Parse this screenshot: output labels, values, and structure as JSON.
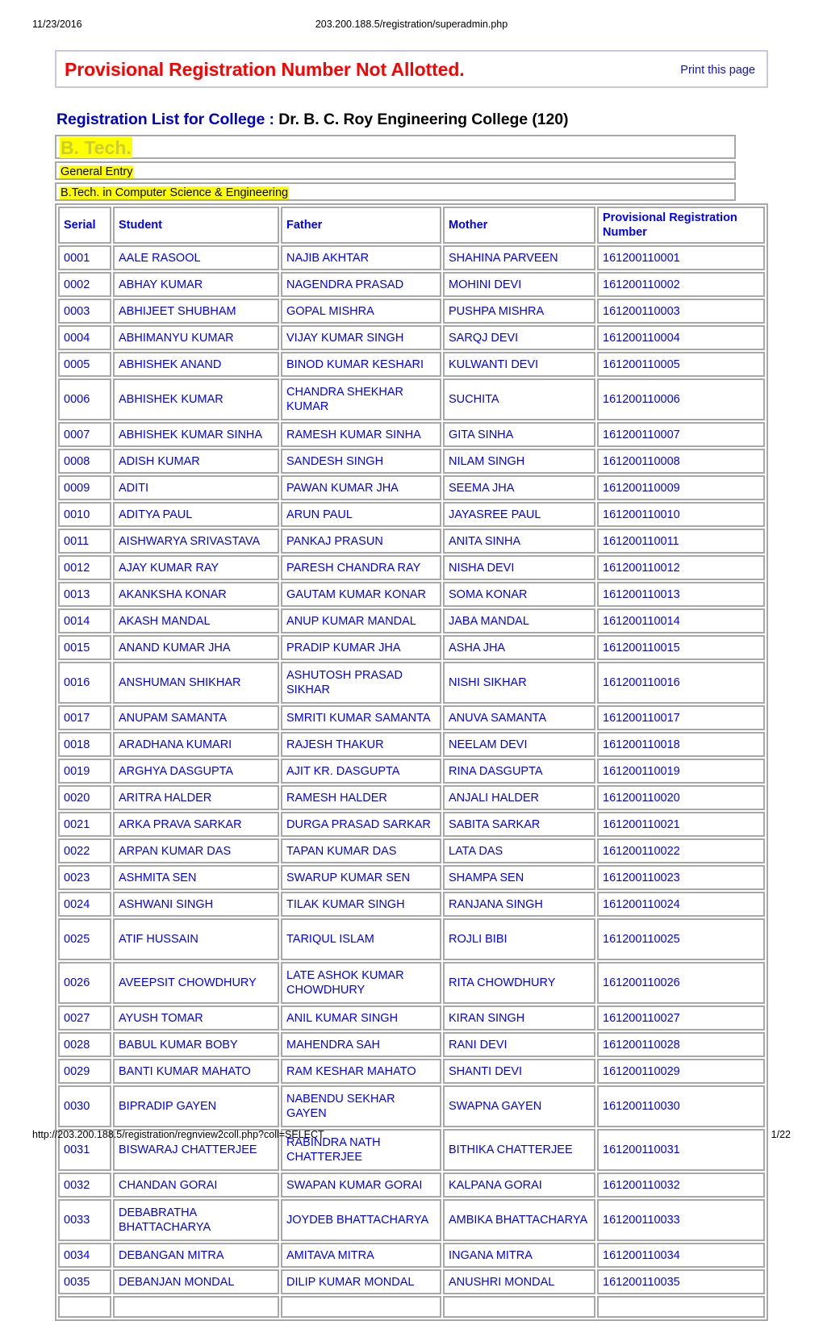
{
  "print_header": {
    "date": "11/23/2016",
    "url": "203.200.188.5/registration/superadmin.php"
  },
  "print_footer": {
    "url": "http://203.200.188.5/registration/regnview2coll.php?coll=SELECT",
    "page": "1/22"
  },
  "banner": {
    "title": "Provisional Registration Number Not Allotted.",
    "print_link": "Print this page",
    "border_color": "#c8c8e0",
    "title_color": "#ff0000",
    "link_color": "#1111cc"
  },
  "heading": {
    "label": "Registration List for College : ",
    "college": "Dr. B. C. Roy Engineering College (120)",
    "label_color": "#0000cd"
  },
  "highlight_rows": [
    {
      "text": "B. Tech.",
      "style": "degree",
      "text_color": "#cdcd32",
      "background": "#ffff00"
    },
    {
      "text": "General Entry",
      "style": "plain",
      "text_color": "#000000",
      "background": "#ffff00"
    },
    {
      "text": "B.Tech. in Computer Science & Engineering",
      "style": "plain",
      "text_color": "#000000",
      "background": "#ffff00"
    }
  ],
  "table": {
    "columns": [
      "Serial",
      "Student",
      "Father",
      "Mother",
      "Provisional Registration Number"
    ],
    "text_color": "#0000ff",
    "border_color": "#a8a8a8",
    "rows": [
      {
        "serial": "0001",
        "student": "AALE RASOOL",
        "father": "NAJIB AKHTAR",
        "mother": "SHAHINA PARVEEN",
        "prn": "161200110001",
        "lines": 1
      },
      {
        "serial": "0002",
        "student": "ABHAY KUMAR",
        "father": "NAGENDRA PRASAD",
        "mother": "MOHINI DEVI",
        "prn": "161200110002",
        "lines": 1
      },
      {
        "serial": "0003",
        "student": "ABHIJEET SHUBHAM",
        "father": "GOPAL MISHRA",
        "mother": "PUSHPA MISHRA",
        "prn": "161200110003",
        "lines": 1
      },
      {
        "serial": "0004",
        "student": "ABHIMANYU KUMAR",
        "father": "VIJAY KUMAR SINGH",
        "mother": "SARQJ DEVI",
        "prn": "161200110004",
        "lines": 1
      },
      {
        "serial": "0005",
        "student": "ABHISHEK ANAND",
        "father": "BINOD KUMAR KESHARI",
        "mother": "KULWANTI DEVI",
        "prn": "161200110005",
        "lines": 1
      },
      {
        "serial": "0006",
        "student": "ABHISHEK KUMAR",
        "father": "CHANDRA SHEKHAR KUMAR",
        "mother": "SUCHITA",
        "prn": "161200110006",
        "lines": 2
      },
      {
        "serial": "0007",
        "student": "ABHISHEK KUMAR SINHA",
        "father": "RAMESH KUMAR SINHA",
        "mother": "GITA SINHA",
        "prn": "161200110007",
        "lines": 1
      },
      {
        "serial": "0008",
        "student": "ADISH KUMAR",
        "father": "SANDESH SINGH",
        "mother": "NILAM SINGH",
        "prn": "161200110008",
        "lines": 1
      },
      {
        "serial": "0009",
        "student": "ADITI",
        "father": "PAWAN KUMAR JHA",
        "mother": "SEEMA JHA",
        "prn": "161200110009",
        "lines": 1
      },
      {
        "serial": "0010",
        "student": "ADITYA PAUL",
        "father": "ARUN PAUL",
        "mother": "JAYASREE PAUL",
        "prn": "161200110010",
        "lines": 1
      },
      {
        "serial": "0011",
        "student": "AISHWARYA SRIVASTAVA",
        "father": "PANKAJ PRASUN",
        "mother": "ANITA SINHA",
        "prn": "161200110011",
        "lines": 1
      },
      {
        "serial": "0012",
        "student": "AJAY KUMAR RAY",
        "father": "PARESH CHANDRA RAY",
        "mother": "NISHA DEVI",
        "prn": "161200110012",
        "lines": 1
      },
      {
        "serial": "0013",
        "student": "AKANKSHA KONAR",
        "father": "GAUTAM KUMAR KONAR",
        "mother": "SOMA KONAR",
        "prn": "161200110013",
        "lines": 1
      },
      {
        "serial": "0014",
        "student": "AKASH MANDAL",
        "father": "ANUP KUMAR MANDAL",
        "mother": "JABA MANDAL",
        "prn": "161200110014",
        "lines": 1
      },
      {
        "serial": "0015",
        "student": "ANAND KUMAR JHA",
        "father": "PRADIP KUMAR JHA",
        "mother": "ASHA JHA",
        "prn": "161200110015",
        "lines": 1
      },
      {
        "serial": "0016",
        "student": "ANSHUMAN SHIKHAR",
        "father": "ASHUTOSH PRASAD SIKHAR",
        "mother": "NISHI SIKHAR",
        "prn": "161200110016",
        "lines": 2
      },
      {
        "serial": "0017",
        "student": "ANUPAM SAMANTA",
        "father": "SMRITI KUMAR SAMANTA",
        "mother": "ANUVA SAMANTA",
        "prn": "161200110017",
        "lines": 1
      },
      {
        "serial": "0018",
        "student": "ARADHANA KUMARI",
        "father": "RAJESH THAKUR",
        "mother": "NEELAM DEVI",
        "prn": "161200110018",
        "lines": 1
      },
      {
        "serial": "0019",
        "student": "ARGHYA DASGUPTA",
        "father": "AJIT KR. DASGUPTA",
        "mother": "RINA DASGUPTA",
        "prn": "161200110019",
        "lines": 1
      },
      {
        "serial": "0020",
        "student": "ARITRA HALDER",
        "father": "RAMESH HALDER",
        "mother": "ANJALI HALDER",
        "prn": "161200110020",
        "lines": 1
      },
      {
        "serial": "0021",
        "student": "ARKA PRAVA SARKAR",
        "father": "DURGA PRASAD SARKAR",
        "mother": "SABITA SARKAR",
        "prn": "161200110021",
        "lines": 1
      },
      {
        "serial": "0022",
        "student": "ARPAN KUMAR DAS",
        "father": "TAPAN KUMAR DAS",
        "mother": "LATA DAS",
        "prn": "161200110022",
        "lines": 1
      },
      {
        "serial": "0023",
        "student": "ASHMITA SEN",
        "father": "SWARUP KUMAR SEN",
        "mother": "SHAMPA SEN",
        "prn": "161200110023",
        "lines": 1
      },
      {
        "serial": "0024",
        "student": "ASHWANI SINGH",
        "father": "TILAK KUMAR SINGH",
        "mother": "RANJANA SINGH",
        "prn": "161200110024",
        "lines": 1
      },
      {
        "serial": "0025",
        "student": "ATIF HUSSAIN",
        "father": "TARIQUL ISLAM",
        "mother": "ROJLI BIBI",
        "prn": "161200110025",
        "lines": 2
      },
      {
        "serial": "0026",
        "student": "AVEEPSIT CHOWDHURY",
        "father": "LATE ASHOK KUMAR CHOWDHURY",
        "mother": "RITA CHOWDHURY",
        "prn": "161200110026",
        "lines": 2
      },
      {
        "serial": "0027",
        "student": "AYUSH TOMAR",
        "father": "ANIL KUMAR SINGH",
        "mother": "KIRAN SINGH",
        "prn": "161200110027",
        "lines": 1
      },
      {
        "serial": "0028",
        "student": "BABUL KUMAR BOBY",
        "father": "MAHENDRA SAH",
        "mother": "RANI DEVI",
        "prn": "161200110028",
        "lines": 1
      },
      {
        "serial": "0029",
        "student": "BANTI KUMAR MAHATO",
        "father": "RAM KESHAR MAHATO",
        "mother": "SHANTI DEVI",
        "prn": "161200110029",
        "lines": 1
      },
      {
        "serial": "0030",
        "student": "BIPRADIP GAYEN",
        "father": "NABENDU SEKHAR GAYEN",
        "mother": "SWAPNA GAYEN",
        "prn": "161200110030",
        "lines": 2
      },
      {
        "serial": "0031",
        "student": "BISWARAJ CHATTERJEE",
        "father": "RABINDRA NATH CHATTERJEE",
        "mother": "BITHIKA CHATTERJEE",
        "prn": "161200110031",
        "lines": 2
      },
      {
        "serial": "0032",
        "student": "CHANDAN GORAI",
        "father": "SWAPAN KUMAR GORAI",
        "mother": "KALPANA GORAI",
        "prn": "161200110032",
        "lines": 1
      },
      {
        "serial": "0033",
        "student": "DEBABRATHA BHATTACHARYA",
        "father": "JOYDEB BHATTACHARYA",
        "mother": "AMBIKA BHATTACHARYA",
        "prn": "161200110033",
        "lines": 2
      },
      {
        "serial": "0034",
        "student": "DEBANGAN MITRA",
        "father": "AMITAVA MITRA",
        "mother": "INGANA MITRA",
        "prn": "161200110034",
        "lines": 1
      },
      {
        "serial": "0035",
        "student": "DEBANJAN MONDAL",
        "father": "DILIP KUMAR MONDAL",
        "mother": "ANUSHRI MONDAL",
        "prn": "161200110035",
        "lines": 1
      }
    ]
  }
}
